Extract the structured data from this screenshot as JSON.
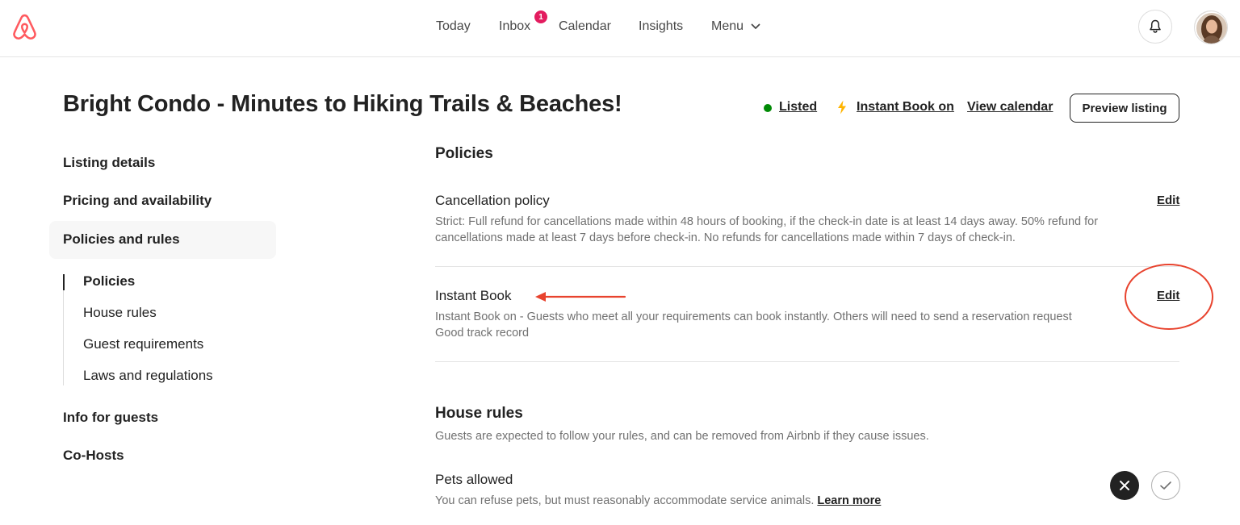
{
  "header": {
    "nav": [
      {
        "label": "Today"
      },
      {
        "label": "Inbox",
        "badge": "1"
      },
      {
        "label": "Calendar"
      },
      {
        "label": "Insights"
      },
      {
        "label": "Menu"
      }
    ],
    "brand_color": "#ff5a5f",
    "badge_color": "#e31c5f"
  },
  "listing": {
    "title": "Bright Condo - Minutes to Hiking Trails & Beaches!",
    "status_listed": "Listed",
    "status_instant": "Instant Book on",
    "view_calendar": "View calendar",
    "preview_button": "Preview listing"
  },
  "sidebar": {
    "items": [
      {
        "label": "Listing details"
      },
      {
        "label": "Pricing and availability"
      },
      {
        "label": "Policies and rules",
        "active": true
      },
      {
        "label": "Info for guests"
      },
      {
        "label": "Co-Hosts"
      }
    ],
    "subitems": [
      {
        "label": "Policies",
        "active": true
      },
      {
        "label": "House rules"
      },
      {
        "label": "Guest requirements"
      },
      {
        "label": "Laws and regulations"
      }
    ]
  },
  "main": {
    "policies_title": "Policies",
    "cancellation": {
      "title": "Cancellation policy",
      "desc": "Strict: Full refund for cancellations made within 48 hours of booking, if the check-in date is at least 14 days away. 50% refund for cancellations made at least 7 days before check-in. No refunds for cancellations made within 7 days of check-in.",
      "edit": "Edit"
    },
    "instant_book": {
      "title": "Instant Book",
      "desc_line1": "Instant Book on - Guests who meet all your requirements can book instantly. Others will need to send a reservation request",
      "desc_line2": "Good track record",
      "edit": "Edit"
    },
    "house_rules": {
      "title": "House rules",
      "desc": "Guests are expected to follow your rules, and can be removed from Airbnb if they cause issues."
    },
    "pets": {
      "title": "Pets allowed",
      "desc": "You can refuse pets, but must reasonably accommodate service animals.",
      "learn_more": "Learn more",
      "selected": "no"
    }
  },
  "annotation_color": "#e8432e"
}
